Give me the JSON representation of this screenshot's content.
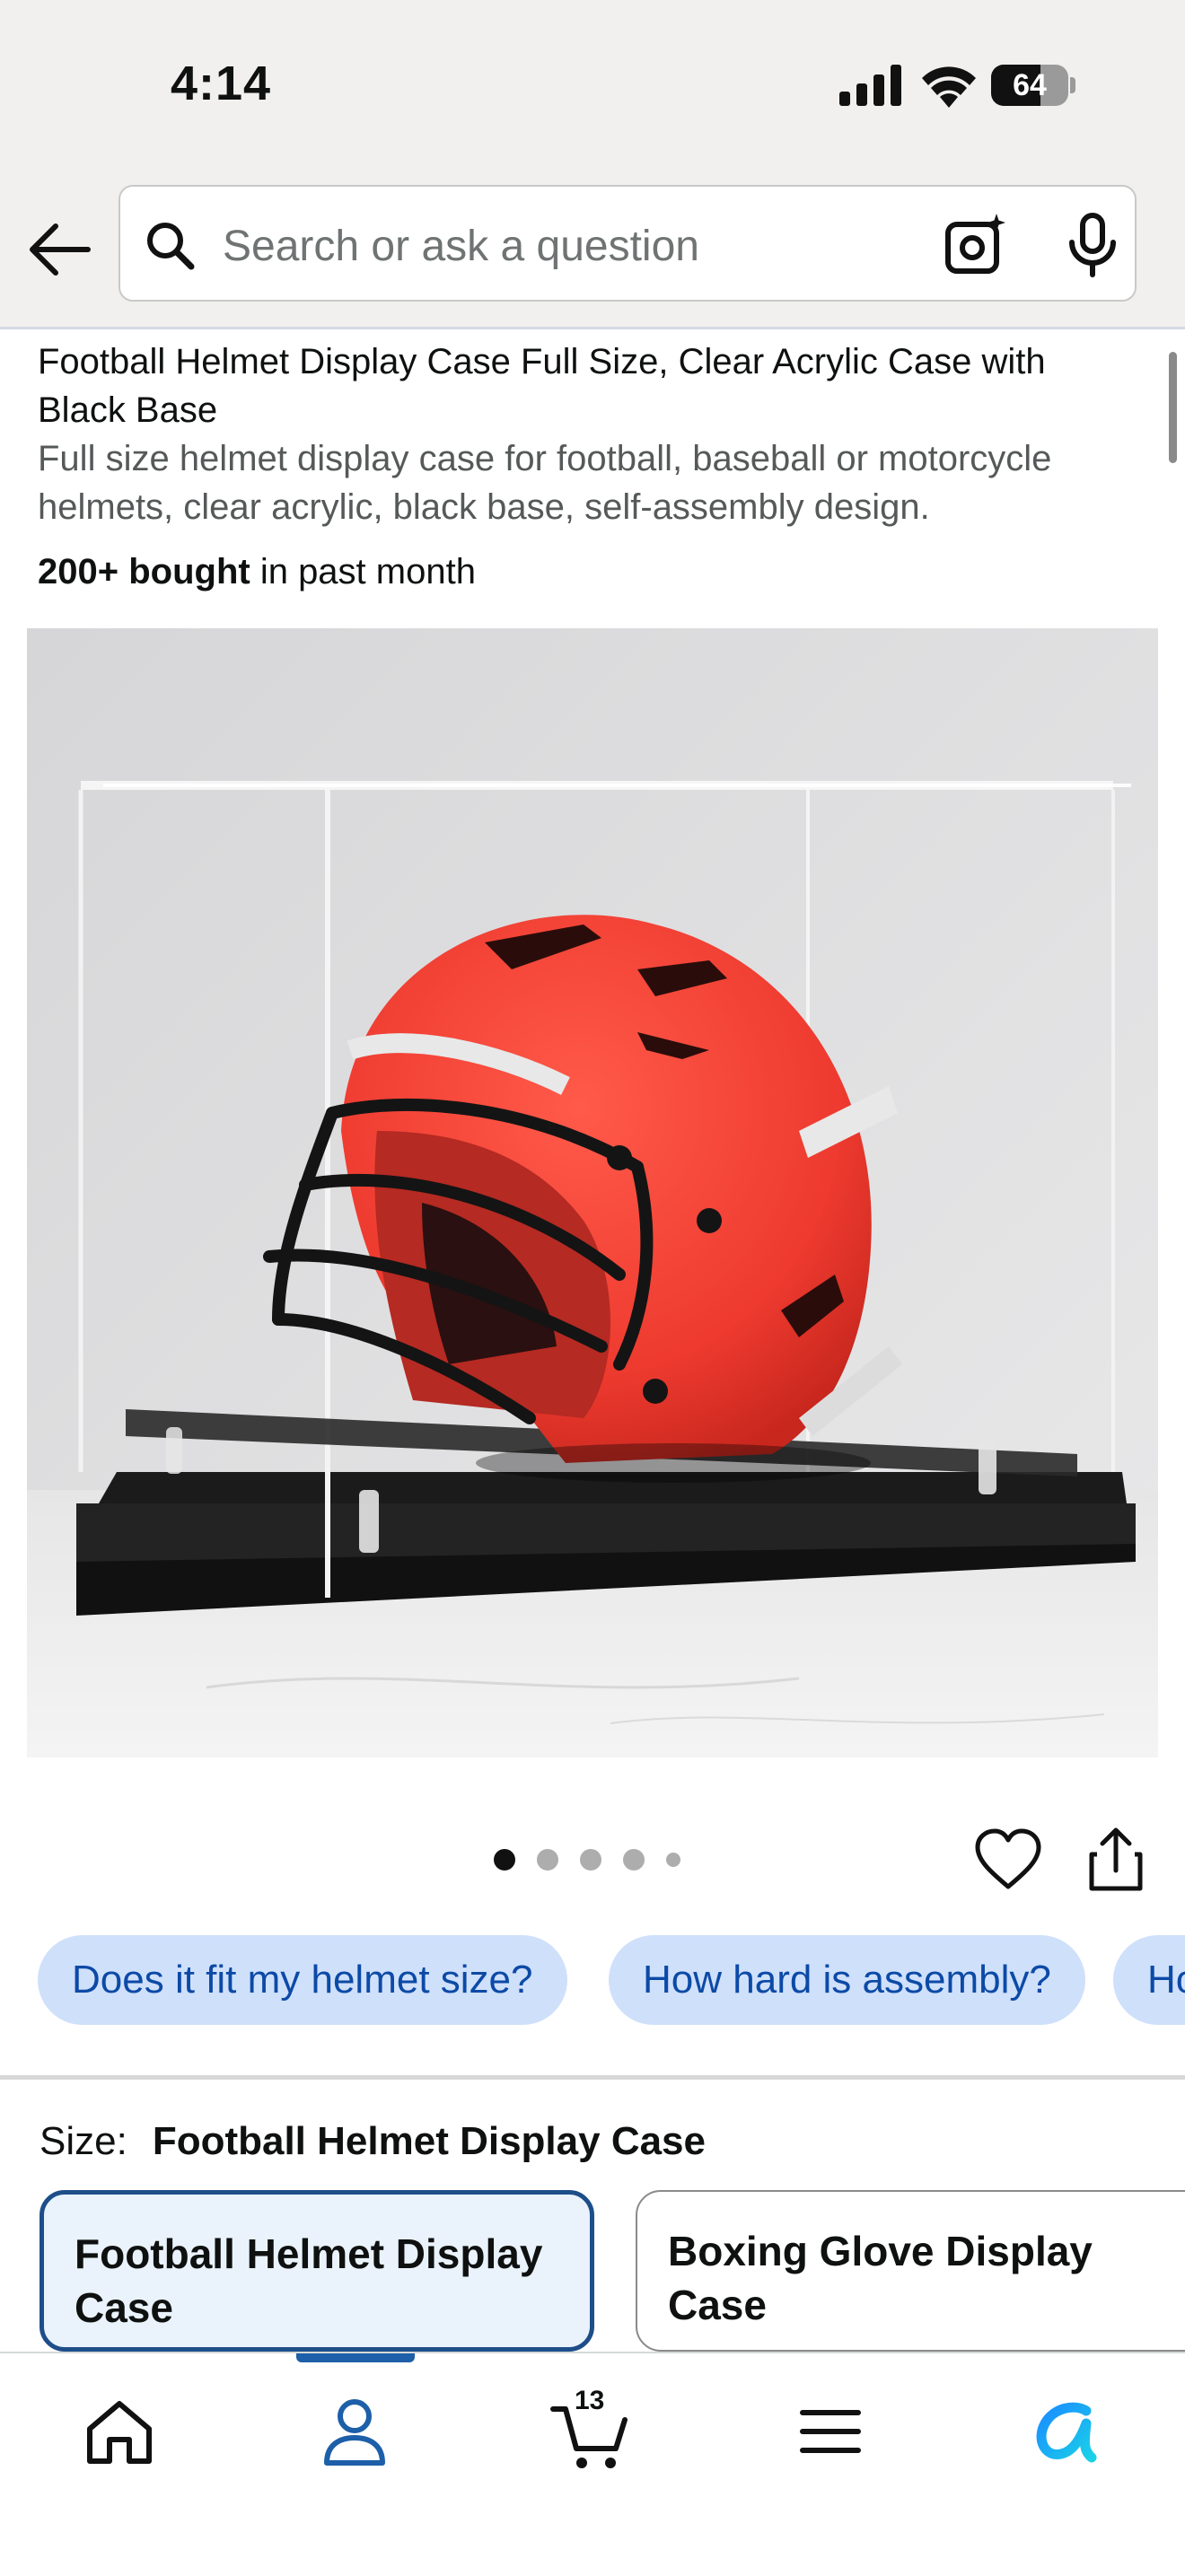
{
  "status": {
    "time": "4:14",
    "battery": "64",
    "battery_level": 0.64
  },
  "search": {
    "placeholder": "Search or ask a question"
  },
  "product": {
    "title": "Football Helmet Display Case Full Size, Clear Acrylic Case with Black Base",
    "subtitle": "Full size helmet display case for football, baseball or motorcycle helmets, clear acrylic, black base, self-assembly design.",
    "bought_bold": "200+ bought",
    "bought_rest": " in past month",
    "image_alt": "Red football helmet inside clear acrylic display case with black base"
  },
  "carousel": {
    "total_images": 5,
    "current_index": 0
  },
  "questions": [
    "Does it fit my helmet size?",
    "How hard is assembly?",
    "How"
  ],
  "size": {
    "label": "Size:",
    "value": "Football Helmet Display Case",
    "options": [
      {
        "label": "Football Helmet Display Case",
        "selected": true
      },
      {
        "label": "Boxing Glove Display Case",
        "selected": false
      }
    ]
  },
  "nav": {
    "cart_count": "13",
    "items": [
      "home-icon",
      "profile-icon",
      "cart-icon",
      "menu-icon",
      "rufus-icon"
    ],
    "active_index": 1
  },
  "colors": {
    "accent": "#1d5fa8",
    "chip_bg": "#cfe0fb",
    "chip_text": "#0c4aa6",
    "helmet_red": "#ee3a2f"
  }
}
